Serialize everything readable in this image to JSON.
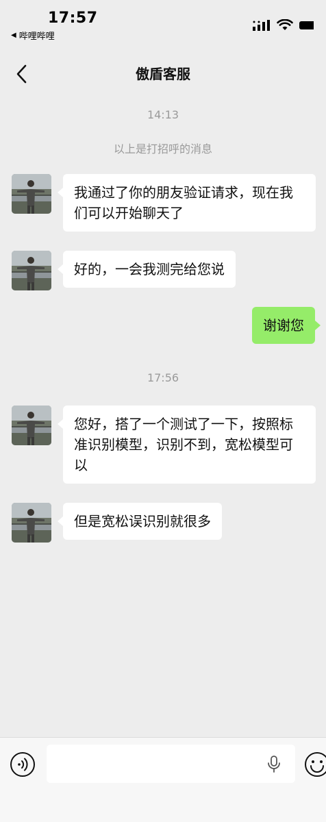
{
  "status_bar": {
    "time": "17:57",
    "back_app": "哔哩哔哩"
  },
  "nav": {
    "title": "傲盾客服",
    "back_icon": "chevron-left-icon"
  },
  "chat": {
    "timestamps": [
      "14:13",
      "17:56"
    ],
    "system_message": "以上是打招呼的消息",
    "messages": [
      {
        "side": "left",
        "text": "我通过了你的朋友验证请求，现在我们可以开始聊天了"
      },
      {
        "side": "left",
        "text": "好的，一会我测完给您说"
      },
      {
        "side": "right",
        "text": "谢谢您"
      },
      {
        "side": "left",
        "text": "您好，搭了一个测试了一下，按照标准识别模型，识别不到，宽松模型可以"
      },
      {
        "side": "left",
        "text": "但是宽松误识别就很多"
      }
    ]
  },
  "input_bar": {
    "value": "",
    "voice_icon": "voice-icon",
    "mic_icon": "mic-icon",
    "emoji_icon": "emoji-icon"
  },
  "colors": {
    "background": "#ededed",
    "bubble_left": "#ffffff",
    "bubble_right": "#95ec69",
    "meta_text": "#9a9a9a"
  }
}
